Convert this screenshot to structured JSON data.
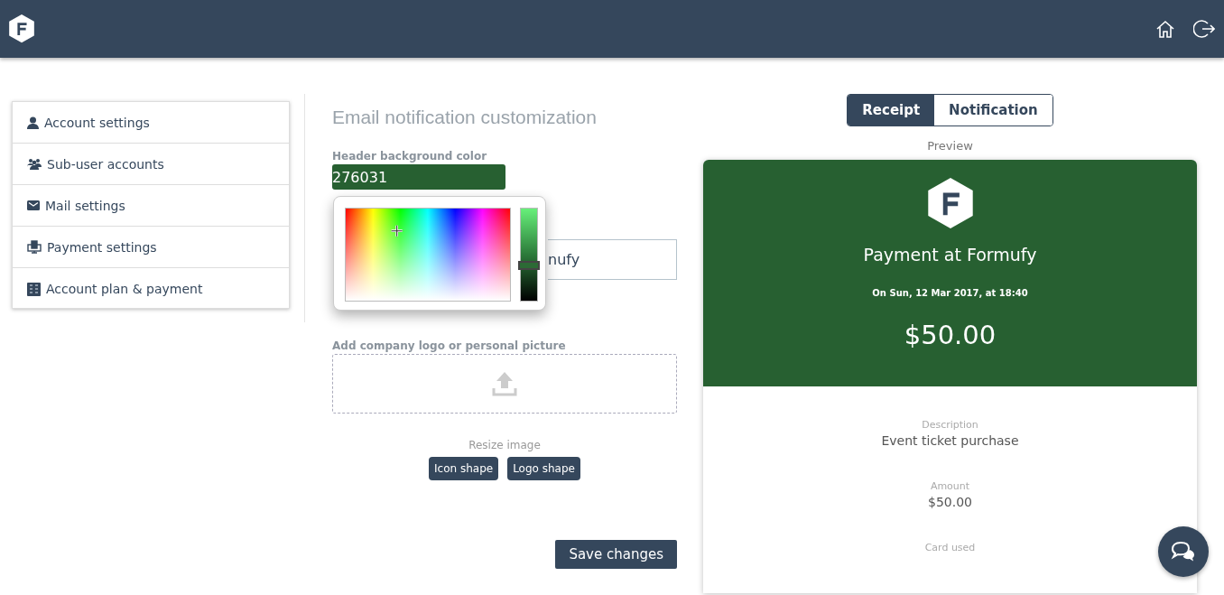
{
  "sidebar": {
    "items": [
      {
        "label": "Account settings",
        "kind": "user",
        "selected": false
      },
      {
        "label": "Sub-user accounts",
        "kind": "users",
        "selected": false
      },
      {
        "label": "Mail settings",
        "kind": "mail",
        "selected": false
      },
      {
        "label": "Payment settings",
        "kind": "terminal",
        "selected": false
      },
      {
        "label": "Account plan & payment",
        "kind": "plan",
        "selected": false
      }
    ]
  },
  "editor": {
    "title": "Email notification customization",
    "header_color": {
      "label": "Header background color",
      "value": "276031"
    },
    "color_picker": {
      "level": 0.38
    },
    "hidden_field": {
      "value": "nufy"
    },
    "logo_upload": {
      "label": "Add company logo or personal picture"
    },
    "resize": {
      "label": "Resize image",
      "buttons": [
        "Icon shape",
        "Logo shape"
      ]
    },
    "save_button": "Save changes"
  },
  "preview": {
    "tabs": [
      {
        "label": "Receipt",
        "selected": true
      },
      {
        "label": "Notification",
        "selected": false
      }
    ],
    "caption": "Preview",
    "title": "Payment at Formufy",
    "date": "On Sun, 12 Mar 2017, at 18:40",
    "total": "$50.00",
    "fields": [
      {
        "label": "Description",
        "value": "Event ticket purchase"
      },
      {
        "label": "Amount",
        "value": "$50.00"
      },
      {
        "label": "Card used"
      }
    ]
  }
}
